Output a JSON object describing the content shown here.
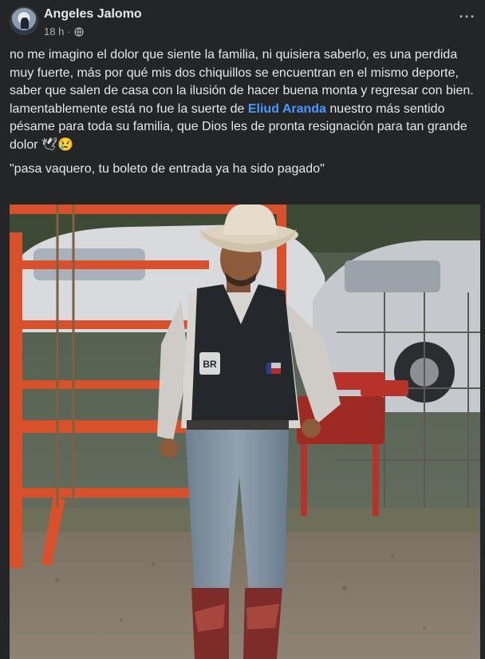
{
  "post": {
    "author": "Angeles Jalomo",
    "time": "18 h",
    "separator": "·",
    "visibility_icon": "globe-icon",
    "more_icon": "more-options-icon",
    "more_label": "···",
    "text": {
      "para1": "no me imagino el dolor que siente la familia, ni quisiera saberlo, es una perdida muy fuerte, más por qué mis dos chiquillos se encuentran en el mismo deporte, saber que salen de casa con la ilusión de hacer buena monta y regresar con bien.",
      "para2_before": "lamentablemente está no fue la suerte de ",
      "mention": "Eliud Aranda",
      "para2_after": " nuestro más sentido pésame para toda su familia, que Dios les de pronta resignación para tan grande dolor ",
      "emojis": "🕊😢",
      "quote": "\"pasa vaquero, tu boleto de entrada ya ha sido pagado\""
    },
    "photo": {
      "vest_patch_left": "BR"
    }
  },
  "colors": {
    "background": "#242526",
    "text": "#e4e6eb",
    "secondary_text": "#b0b3b8",
    "mention": "#4599ff"
  }
}
